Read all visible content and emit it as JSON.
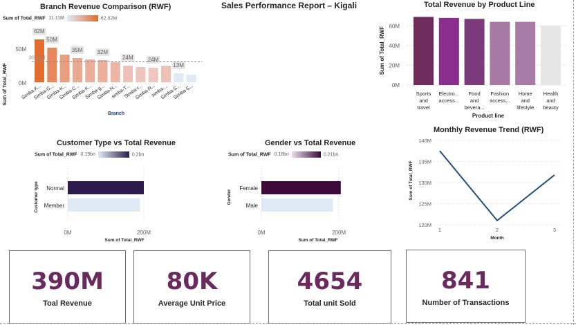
{
  "page_title": "Sales Performance Report – Kigali",
  "colors": {
    "kpi_value": "#6b2a5e",
    "branch_high": "#e36c2f",
    "product_high": "#6e2c5c",
    "dark_purple": "#2d1b4e",
    "light_blue": "#deebf7",
    "trend_line": "#1f4e79"
  },
  "chart_data": [
    {
      "id": "branch",
      "type": "bar",
      "title": "Branch Revenue Comparison (RWF)",
      "legend_title": "Sum of Total_RWF",
      "legend_min": "11.11M",
      "legend_max": "62.02M",
      "ylabel": "Sum of Total_RWF",
      "xlabel": "Branch",
      "y_ticks": [
        "0M",
        "50M"
      ],
      "ylim": [
        0,
        70
      ],
      "reference_label": "30.29M",
      "reference_value": 30.29,
      "categories": [
        "Simba-K...",
        "Simba-G...",
        "Simba-K...",
        "Simba-C...",
        "Simba-K...",
        "Simba-g...",
        "Simba-N...",
        "simba-T...",
        "Simba-r...",
        "Simba-R...",
        "simba-...",
        "Simba-S...",
        "Simba-S..."
      ],
      "values": [
        62,
        50,
        40,
        35,
        33,
        32,
        29,
        24,
        22,
        21,
        24,
        13,
        11
      ],
      "data_labels": [
        "62M",
        "50M",
        "",
        "35M",
        "",
        "32M",
        "",
        "24M",
        "",
        "24M",
        "",
        "13M",
        ""
      ]
    },
    {
      "id": "product",
      "type": "bar",
      "title": "Total Revenue by Product Line",
      "ylabel": "Sum of Total_RWF",
      "xlabel": "Product line",
      "y_ticks": [
        "0M",
        "20M",
        "40M",
        "60M"
      ],
      "ylim": [
        0,
        70
      ],
      "categories": [
        [
          "Sports",
          "and",
          "travel"
        ],
        [
          "Electro...",
          "access..."
        ],
        [
          "Food",
          "and",
          "bevera..."
        ],
        [
          "Fashion",
          "access..."
        ],
        [
          "Home",
          "and",
          "lifestyle"
        ],
        [
          "Health",
          "and",
          "beauty"
        ]
      ],
      "values": [
        69,
        68,
        67,
        64,
        64,
        60
      ]
    },
    {
      "id": "customer",
      "type": "bar",
      "orientation": "horizontal",
      "title": "Customer Type vs Total Revenue",
      "legend_title": "Sum of Total_RWF",
      "legend_min": "0.19bn",
      "legend_max": "0.2bn",
      "ylabel": "Customer type",
      "xlabel": "Sum of Total_RWF",
      "x_ticks": [
        "0M",
        "200M"
      ],
      "xlim": [
        0,
        200
      ],
      "categories": [
        "Normal",
        "Member"
      ],
      "values": [
        200,
        190
      ]
    },
    {
      "id": "gender",
      "type": "bar",
      "orientation": "horizontal",
      "title": "Gender vs Total Revenue",
      "legend_title": "Sum of Total_RWF",
      "legend_min": "0.18bn",
      "legend_max": "0.21bn",
      "ylabel": "Gender",
      "xlabel": "Sum of Total_RWF",
      "x_ticks": [
        "0M",
        "200M"
      ],
      "xlim": [
        0,
        200
      ],
      "categories": [
        "Female",
        "Male"
      ],
      "values": [
        205,
        185
      ]
    },
    {
      "id": "monthly",
      "type": "line",
      "title": "Monthly Revenue Trend (RWF)",
      "ylabel": "Sum of Total_RWF",
      "xlabel": "Month",
      "x": [
        1,
        2,
        3
      ],
      "x_ticks": [
        "1",
        "2",
        "3"
      ],
      "y": [
        137.5,
        121,
        131.8
      ],
      "y_ticks": [
        "120M",
        "125M",
        "130M",
        "135M",
        "140M"
      ],
      "ylim": [
        120,
        140
      ]
    }
  ],
  "kpis": [
    {
      "value": "390M",
      "label": "Toal Revenue"
    },
    {
      "value": "80K",
      "label": "Average Unit Price"
    },
    {
      "value": "4654",
      "label": "Total unit Sold"
    },
    {
      "value": "841",
      "label": "Number of Transactions"
    }
  ]
}
